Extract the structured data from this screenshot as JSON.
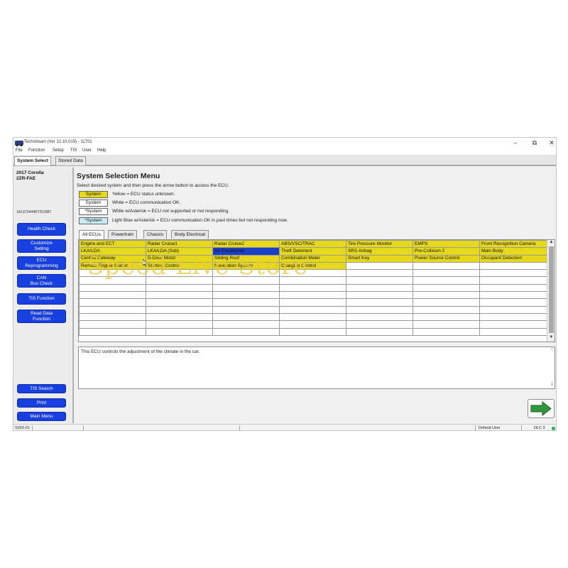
{
  "window": {
    "title": "Techstream (Ver 12.10.019) - 11701",
    "minimize": "–",
    "maximize": "⧉",
    "close": "✕"
  },
  "menu": [
    "File",
    "Function",
    "Setup",
    "TIS",
    "User",
    "Help"
  ],
  "top_tabs": [
    {
      "label": "System Select",
      "active": true
    },
    {
      "label": "Stored Data",
      "active": false
    }
  ],
  "sidebar": {
    "vehicle_line1": "2017 Corolla",
    "vehicle_line2": "2ZR-FAE",
    "vin": "1A1JC5444R7252987",
    "buttons_top": [
      "Health Check",
      "Customize\nSetting",
      "ECU\nReprogramming",
      "CAN\nBus Check",
      "TIS Function",
      "Read Data\nFunction"
    ],
    "buttons_bottom": [
      "TIS Search",
      "Print",
      "Main Menu"
    ]
  },
  "main": {
    "heading": "System Selection Menu",
    "instructions": "Select desired system and then press the arrow button to access the ECU.",
    "legend": [
      {
        "box": "System",
        "text": "Yellow = ECU status unknown.",
        "color": "#e6d81a"
      },
      {
        "box": "System",
        "text": "White = ECU communication OK.",
        "color": "#ffffff"
      },
      {
        "box": "*System",
        "text": "White w/Asterisk = ECU not supported or not responding.",
        "color": "#ffffff"
      },
      {
        "box": "*System",
        "text": "Light Blue w/Asterisk = ECU communication OK in past times but not responding now.",
        "color": "#c9ecf4"
      }
    ],
    "tabs": [
      {
        "label": "All ECUs",
        "active": true
      },
      {
        "label": "Powertrain",
        "active": false
      },
      {
        "label": "Chassis",
        "active": false
      },
      {
        "label": "Body Electrical",
        "active": false
      }
    ],
    "grid": [
      [
        {
          "t": "Engine and ECT",
          "s": "yellow"
        },
        {
          "t": "Radar Cruise1",
          "s": "yellow"
        },
        {
          "t": "Radar Cruise2",
          "s": "yellow"
        },
        {
          "t": "ABS/VSC/TRAC",
          "s": "yellow"
        },
        {
          "t": "Tire Pressure Monitor",
          "s": "yellow"
        },
        {
          "t": "EMPS",
          "s": "yellow"
        },
        {
          "t": "Front Recognition Camera",
          "s": "yellow"
        }
      ],
      [
        {
          "t": "LKA/LDA",
          "s": "yellow"
        },
        {
          "t": "LKA/LDA (Sub)",
          "s": "yellow"
        },
        {
          "t": "Air Conditioner",
          "s": "selected"
        },
        {
          "t": "Theft Deterrent",
          "s": "yellow"
        },
        {
          "t": "SRS Airbag",
          "s": "yellow"
        },
        {
          "t": "Pre-Collision 2",
          "s": "yellow"
        },
        {
          "t": "Main Body",
          "s": "yellow"
        }
      ],
      [
        {
          "t": "Central Gateway",
          "s": "yellow"
        },
        {
          "t": "D-Door Motor",
          "s": "yellow"
        },
        {
          "t": "Sliding Roof",
          "s": "yellow"
        },
        {
          "t": "Combination Meter",
          "s": "yellow"
        },
        {
          "t": "Smart Key",
          "s": "yellow"
        },
        {
          "t": "Power Source Control",
          "s": "yellow"
        },
        {
          "t": "Occupant Detection",
          "s": "yellow"
        }
      ],
      [
        {
          "t": "Remote Engine Starter",
          "s": "yellow"
        },
        {
          "t": "Starting Control",
          "s": "yellow"
        },
        {
          "t": "Navigation System",
          "s": "yellow"
        },
        {
          "t": "Charging Control",
          "s": "yellow"
        },
        {
          "t": "",
          "s": "white"
        },
        {
          "t": "",
          "s": "white"
        },
        {
          "t": "",
          "s": "white"
        }
      ]
    ],
    "empty_rows": 9,
    "description": "This ECU controls the adjustment of the climate in the car."
  },
  "watermark": "Speed Live Store",
  "status": {
    "code": "S303-01",
    "user": "Default User",
    "dlc": "DLC 3"
  },
  "colors": {
    "accent_blue": "#1840e0",
    "ecu_yellow": "#e6d81a",
    "selected_blue": "#1c3fc7",
    "status_ok": "#22b24a",
    "arrow_green": "#2e9a3c"
  }
}
